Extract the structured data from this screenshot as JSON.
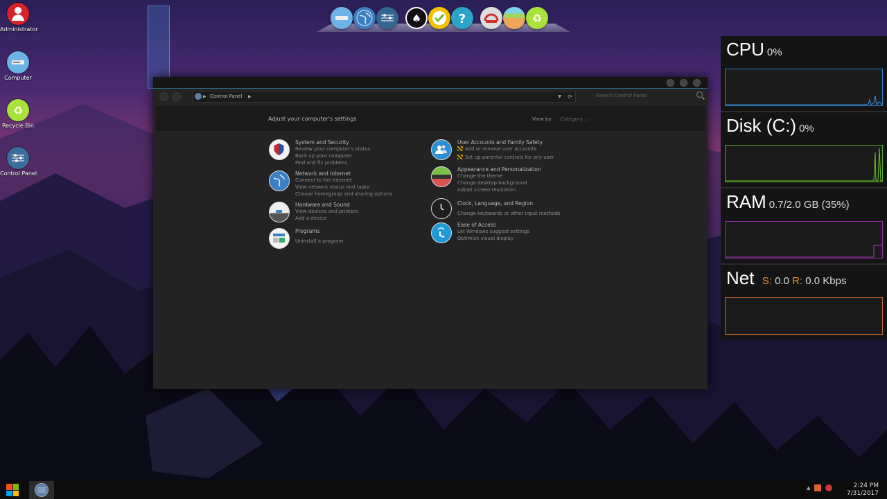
{
  "desktop": {
    "icons": [
      {
        "label": "Administrator",
        "icon": "user-icon"
      },
      {
        "label": "Computer",
        "icon": "computer-icon"
      },
      {
        "label": "Recycle Bin",
        "icon": "recycle-bin-icon"
      },
      {
        "label": "Control Panel",
        "icon": "control-panel-icon"
      }
    ]
  },
  "dock": {
    "items": [
      "computer-icon",
      "globe-icon",
      "control-panel-icon",
      "spade-icon",
      "checkmark-icon",
      "help-icon",
      "gauge-icon",
      "appearance-icon",
      "recycle-icon"
    ]
  },
  "window": {
    "breadcrumb": "Control Panel",
    "search_placeholder": "Search Control Panel",
    "header_title": "Adjust your computer's settings",
    "view_by_label": "View by:",
    "view_by_value": "Category",
    "categories_left": [
      {
        "title": "System and Security",
        "icon": "shield-icon",
        "links": [
          "Review your computer's status",
          "Back up your computer",
          "Find and fix problems"
        ]
      },
      {
        "title": "Network and Internet",
        "icon": "globe-icon",
        "links": [
          "Connect to the Internet",
          "View network status and tasks",
          "Choose homegroup and sharing options"
        ]
      },
      {
        "title": "Hardware and Sound",
        "icon": "printer-icon",
        "links": [
          "View devices and printers",
          "Add a device"
        ]
      },
      {
        "title": "Programs",
        "icon": "programs-icon",
        "links": [
          "Uninstall a program"
        ]
      }
    ],
    "categories_right": [
      {
        "title": "User Accounts and Family Safety",
        "icon": "users-icon",
        "links": [
          "Add or remove user accounts",
          "Set up parental controls for any user"
        ]
      },
      {
        "title": "Appearance and Personalization",
        "icon": "appearance-icon",
        "links": [
          "Change the theme",
          "Change desktop background",
          "Adjust screen resolution"
        ]
      },
      {
        "title": "Clock, Language, and Region",
        "icon": "clock-icon",
        "links": [
          "Change keyboards or other input methods"
        ]
      },
      {
        "title": "Ease of Access",
        "icon": "ease-of-access-icon",
        "links": [
          "Let Windows suggest settings",
          "Optimize visual display"
        ]
      }
    ]
  },
  "perf": {
    "cpu": {
      "label": "CPU",
      "value": "0%",
      "color": "#2f7fc1"
    },
    "disk": {
      "label": "Disk (C:)",
      "value": "0%",
      "color": "#5aa51e"
    },
    "ram": {
      "label": "RAM",
      "value": "0.7/2.0 GB (35%)",
      "color": "#8e2a9e"
    },
    "net": {
      "label": "Net",
      "send_label": "S:",
      "send_value": "0.0",
      "recv_label": "R:",
      "recv_value": "0.0 Kbps",
      "color": "#c0662a"
    }
  },
  "taskbar": {
    "time": "2:24 PM",
    "date": "7/31/2017"
  }
}
